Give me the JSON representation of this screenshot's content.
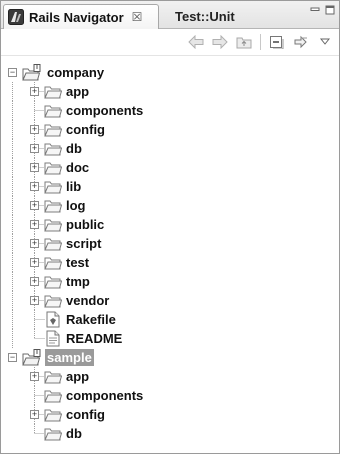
{
  "tabs": [
    {
      "label": "Rails Navigator",
      "close": "☒",
      "icon": "rails-navigator-icon",
      "active": true
    },
    {
      "label": "Test::Unit",
      "active": false
    }
  ],
  "window_controls": {
    "minimize_icon": "minimize-icon",
    "maximize_icon": "maximize-icon"
  },
  "toolbar": {
    "buttons": [
      "back-arrow-icon",
      "forward-arrow-icon",
      "up-folder-icon",
      "collapse-all-icon",
      "link-with-editor-icon",
      "view-menu-icon"
    ]
  },
  "tree": {
    "projects": [
      {
        "name": "company",
        "expanded": true,
        "selected": false,
        "children": [
          {
            "name": "app",
            "type": "folder",
            "expandable": true
          },
          {
            "name": "components",
            "type": "folder",
            "expandable": false
          },
          {
            "name": "config",
            "type": "folder",
            "expandable": true
          },
          {
            "name": "db",
            "type": "folder",
            "expandable": true
          },
          {
            "name": "doc",
            "type": "folder",
            "expandable": true
          },
          {
            "name": "lib",
            "type": "folder",
            "expandable": true
          },
          {
            "name": "log",
            "type": "folder",
            "expandable": true
          },
          {
            "name": "public",
            "type": "folder",
            "expandable": true
          },
          {
            "name": "script",
            "type": "folder",
            "expandable": true
          },
          {
            "name": "test",
            "type": "folder",
            "expandable": true
          },
          {
            "name": "tmp",
            "type": "folder",
            "expandable": true
          },
          {
            "name": "vendor",
            "type": "folder",
            "expandable": true
          },
          {
            "name": "Rakefile",
            "type": "ruby-file",
            "expandable": false
          },
          {
            "name": "README",
            "type": "text-file",
            "expandable": false
          }
        ]
      },
      {
        "name": "sample",
        "expanded": true,
        "selected": true,
        "children": [
          {
            "name": "app",
            "type": "folder",
            "expandable": true
          },
          {
            "name": "components",
            "type": "folder",
            "expandable": false
          },
          {
            "name": "config",
            "type": "folder",
            "expandable": true
          },
          {
            "name": "db",
            "type": "folder",
            "expandable": false
          }
        ]
      }
    ]
  }
}
